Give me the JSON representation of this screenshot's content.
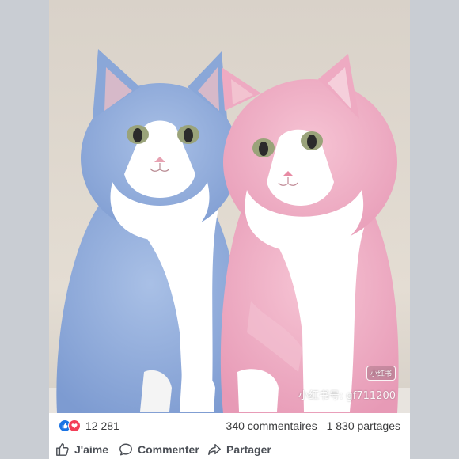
{
  "post": {
    "image_alt": "",
    "watermark_logo": "小红书",
    "watermark_text": "小红书号: gf711200"
  },
  "stats": {
    "reaction_count": "12 281",
    "comments": "340 commentaires",
    "shares": "1 830 partages"
  },
  "actions": {
    "like_label": "J'aime",
    "comment_label": "Commenter",
    "share_label": "Partager"
  },
  "icons": {
    "like": "thumbs-up-icon",
    "love": "heart-icon",
    "comment": "comment-bubble-icon",
    "share": "share-arrow-icon"
  },
  "colors": {
    "like_blue": "#1b74e4",
    "love_red": "#f33e58",
    "blue_cat": "#8aa7d8",
    "pink_cat": "#eeaac2"
  }
}
